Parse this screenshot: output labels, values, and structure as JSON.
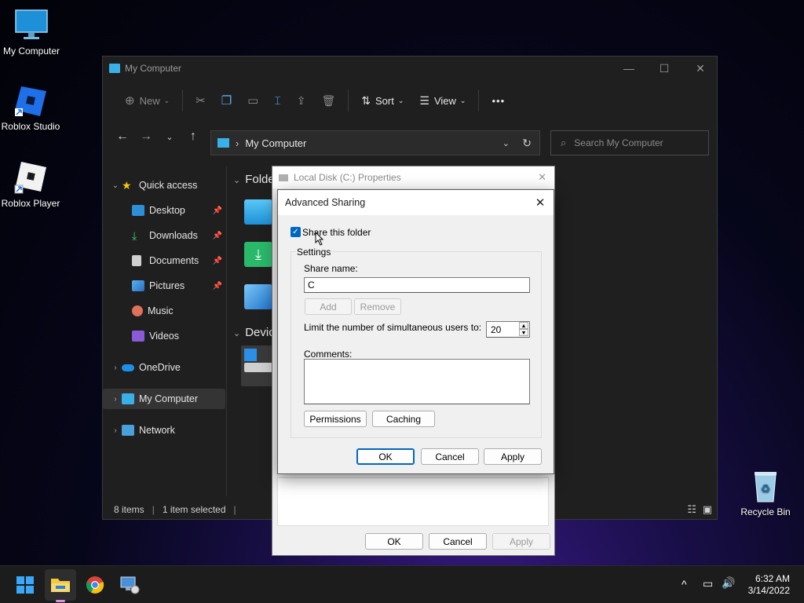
{
  "desktop": {
    "icons": [
      {
        "label": "My Computer"
      },
      {
        "label": "Roblox Studio"
      },
      {
        "label": "Roblox Player"
      },
      {
        "label": "Recycle Bin"
      }
    ]
  },
  "explorer": {
    "title": "My Computer",
    "toolbar": {
      "new_label": "New",
      "sort_label": "Sort",
      "view_label": "View",
      "more_label": "•••"
    },
    "address": "My Computer",
    "search_placeholder": "Search My Computer",
    "sidebar": {
      "items": [
        {
          "label": "Quick access"
        },
        {
          "label": "Desktop"
        },
        {
          "label": "Downloads"
        },
        {
          "label": "Documents"
        },
        {
          "label": "Pictures"
        },
        {
          "label": "Music"
        },
        {
          "label": "Videos"
        },
        {
          "label": "OneDrive"
        },
        {
          "label": "My Computer"
        },
        {
          "label": "Network"
        }
      ]
    },
    "sections": {
      "folders": "Folde",
      "devices": "Devic"
    },
    "status": {
      "items": "8 items",
      "selected": "1 item selected"
    }
  },
  "properties": {
    "title": "Local Disk (C:) Properties",
    "ok": "OK",
    "cancel": "Cancel",
    "apply": "Apply"
  },
  "advanced_sharing": {
    "title": "Advanced Sharing",
    "share_checkbox": "Share this folder",
    "share_checked": true,
    "settings_label": "Settings",
    "share_name_label": "Share name:",
    "share_name_value": "C",
    "add": "Add",
    "remove": "Remove",
    "limit_label": "Limit the number of simultaneous users to:",
    "limit_value": "20",
    "comments_label": "Comments:",
    "comments_value": "",
    "permissions": "Permissions",
    "caching": "Caching",
    "ok": "OK",
    "cancel": "Cancel",
    "apply": "Apply"
  },
  "taskbar": {
    "time": "6:32 AM",
    "date": "3/14/2022"
  },
  "colors": {
    "accent": "#0067c0",
    "folder": "#3ab0e8"
  }
}
